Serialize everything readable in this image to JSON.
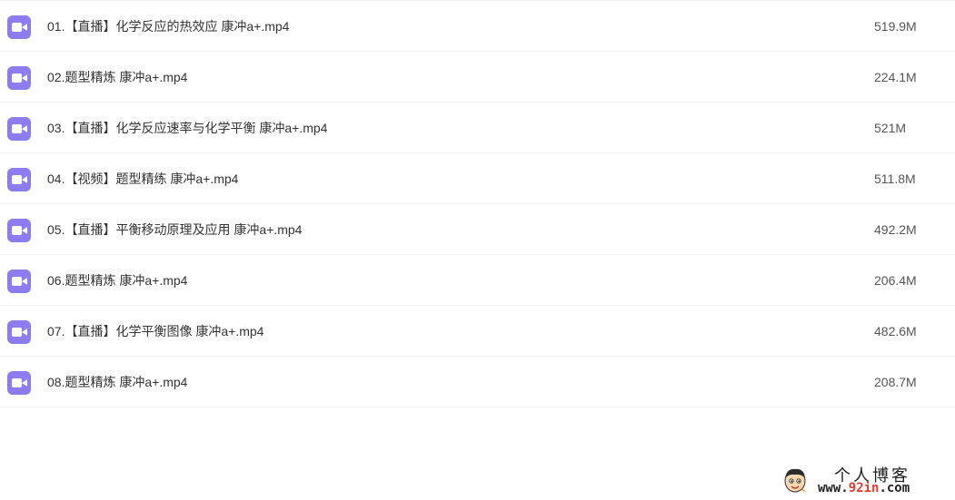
{
  "files": [
    {
      "name": "01.【直播】化学反应的热效应 康冲a+.mp4",
      "size": "519.9M",
      "icon": "video-file-icon"
    },
    {
      "name": "02.题型精炼 康冲a+.mp4",
      "size": "224.1M",
      "icon": "video-file-icon"
    },
    {
      "name": "03.【直播】化学反应速率与化学平衡 康冲a+.mp4",
      "size": "521M",
      "icon": "video-file-icon"
    },
    {
      "name": "04.【视频】题型精练 康冲a+.mp4",
      "size": "511.8M",
      "icon": "video-file-icon"
    },
    {
      "name": "05.【直播】平衡移动原理及应用 康冲a+.mp4",
      "size": "492.2M",
      "icon": "video-file-icon"
    },
    {
      "name": "06.题型精炼 康冲a+.mp4",
      "size": "206.4M",
      "icon": "video-file-icon"
    },
    {
      "name": "07.【直播】化学平衡图像 康冲a+.mp4",
      "size": "482.6M",
      "icon": "video-file-icon"
    },
    {
      "name": "08.题型精炼 康冲a+.mp4",
      "size": "208.7M",
      "icon": "video-file-icon"
    }
  ],
  "watermark": {
    "title": "个人博客",
    "url_prefix": "www.",
    "url_highlight": "92in",
    "url_suffix": ".com"
  },
  "colors": {
    "icon_bg": "#8c7cf0",
    "row_border": "#eeeeee",
    "url_accent": "#e03a2a"
  }
}
